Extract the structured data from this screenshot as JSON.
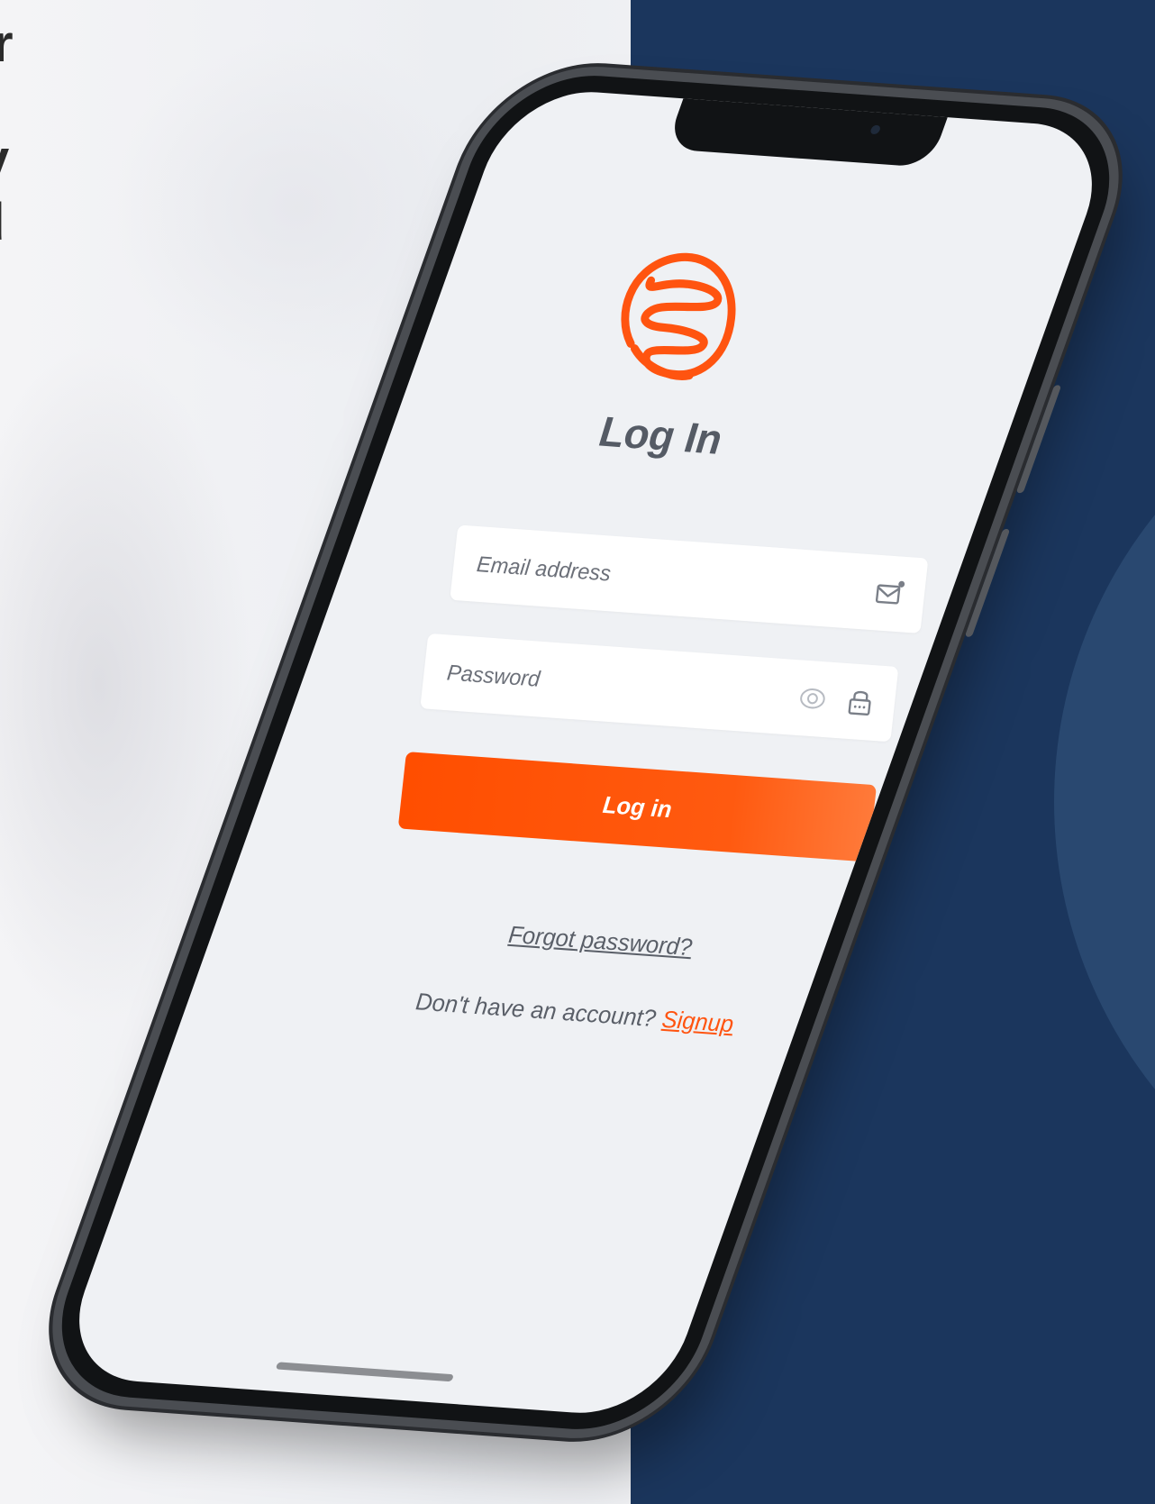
{
  "background": {
    "edge_glyphs": [
      "r",
      "y",
      "d"
    ],
    "navy_color": "#1b365d",
    "circle_color": "#2c4b73"
  },
  "login_screen": {
    "title": "Log In",
    "logo_icon": "orange-swirl-logo",
    "email": {
      "placeholder": "Email address",
      "value": "",
      "icon": "mail-icon"
    },
    "password": {
      "placeholder": "Password",
      "value": "",
      "icons": [
        "eye-icon",
        "lock-icon"
      ]
    },
    "login_button_label": "Log in",
    "forgot_password_label": "Forgot password?",
    "signup_prompt": "Don't have an account?",
    "signup_link_label": "Signup",
    "accent_color": "#ff4e00"
  }
}
